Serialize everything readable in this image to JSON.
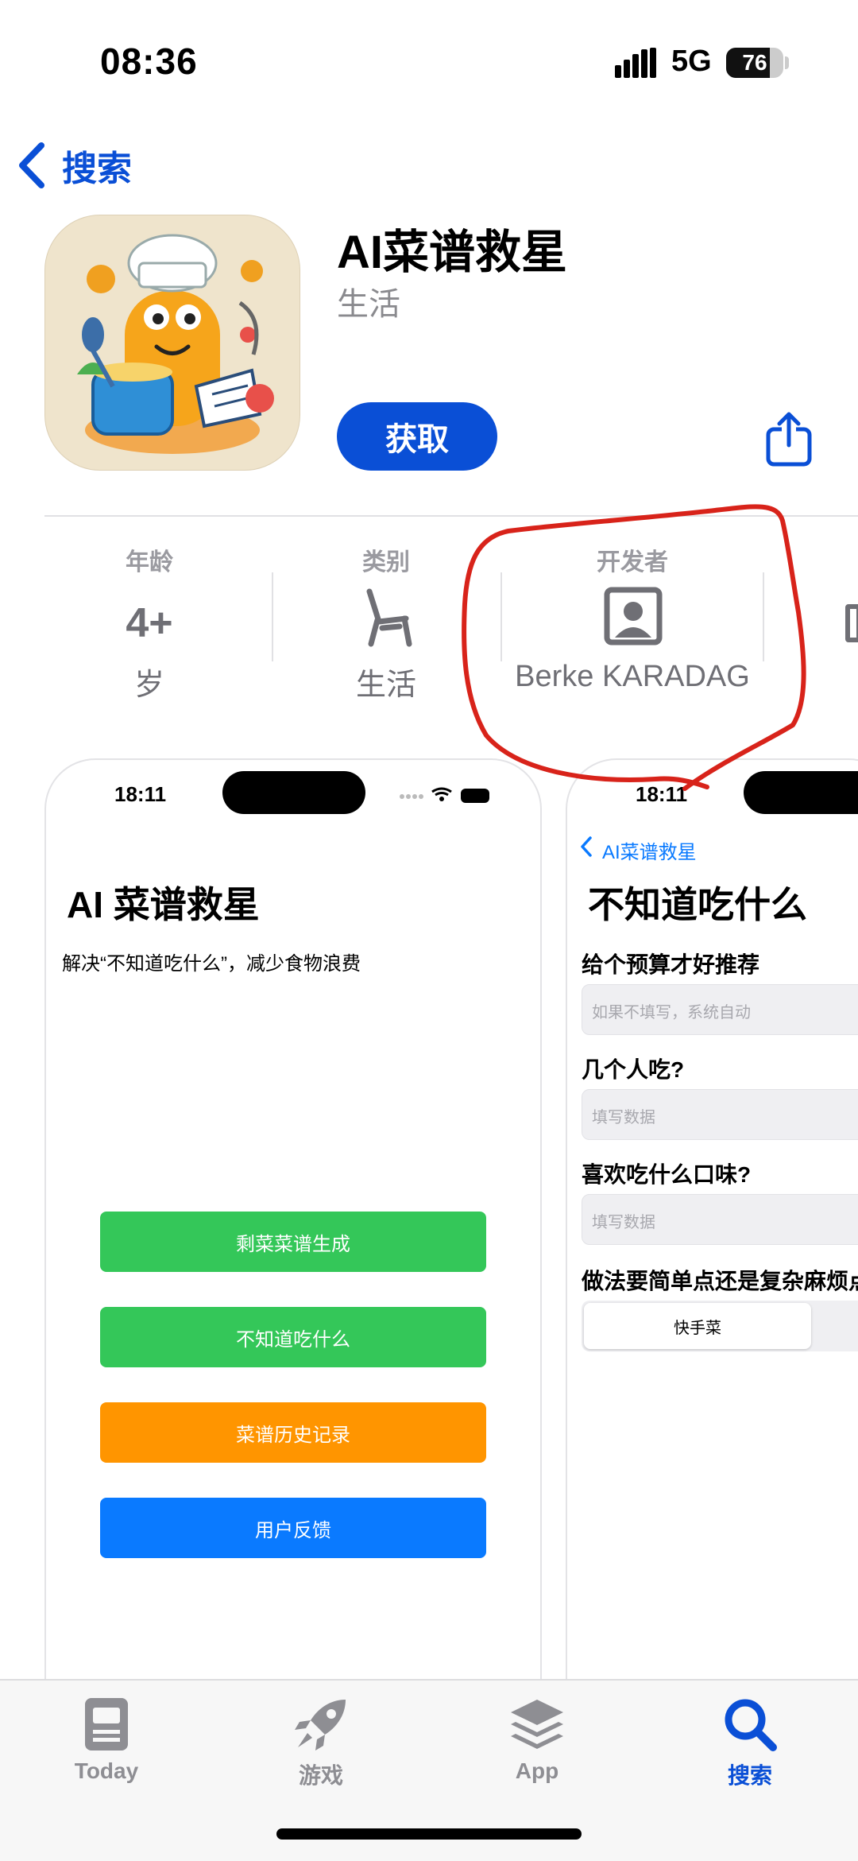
{
  "status": {
    "time": "08:36",
    "network": "5G",
    "battery": "76",
    "battery_level": 0.76
  },
  "nav": {
    "back_label": "搜索"
  },
  "app": {
    "name": "AI菜谱救星",
    "category": "生活",
    "get_label": "获取"
  },
  "info": [
    {
      "label": "年龄",
      "value": "4+",
      "sub": "岁"
    },
    {
      "label": "类别",
      "sub": "生活"
    },
    {
      "label": "开发者",
      "sub": "Berke KARADAG"
    }
  ],
  "screenshot1": {
    "time": "18:11",
    "title": "AI 菜谱救星",
    "subtitle": "解决“不知道吃什么”，减少食物浪费",
    "buttons": [
      "剩菜菜谱生成",
      "不知道吃什么",
      "菜谱历史记录",
      "用户反馈"
    ],
    "button_colors": [
      "#34c759",
      "#34c759",
      "#ff9500",
      "#0a7aff"
    ]
  },
  "screenshot2": {
    "time": "18:11",
    "back_label": "AI菜谱救星",
    "title": "不知道吃什么",
    "fields": [
      {
        "label": "给个预算才好推荐",
        "placeholder": "如果不填写，系统自动"
      },
      {
        "label": "几个人吃?",
        "placeholder": "填写数据"
      },
      {
        "label": "喜欢吃什么口味?",
        "placeholder": "填写数据"
      }
    ],
    "complexity_label": "做法要简单点还是复杂麻烦点",
    "segment_selected": "快手菜"
  },
  "tabbar": {
    "tabs": [
      "Today",
      "游戏",
      "App",
      "搜索"
    ],
    "active": "搜索"
  },
  "colors": {
    "accent": "#0a4fd6",
    "annotation": "#d8231a"
  }
}
